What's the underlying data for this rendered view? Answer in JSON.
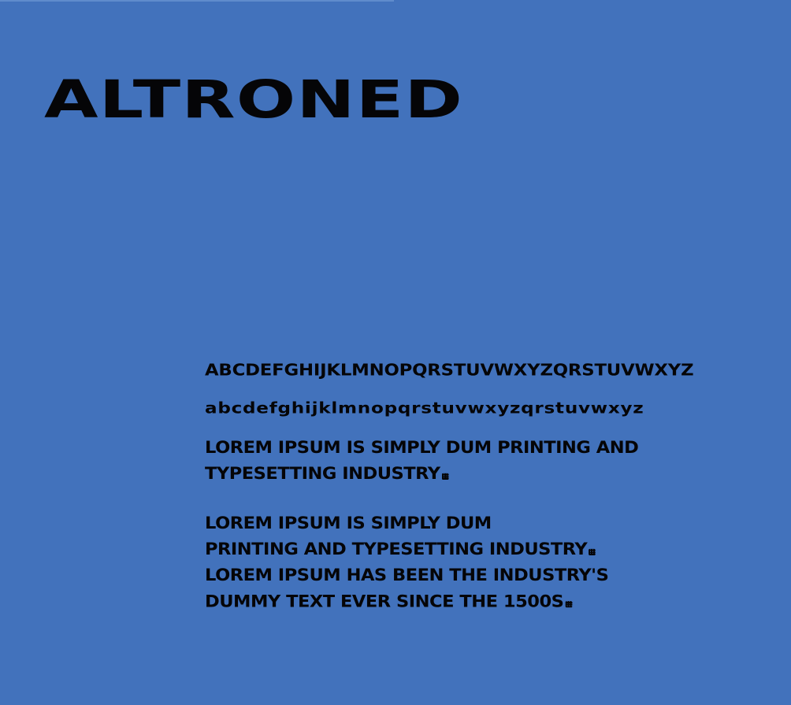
{
  "page": {
    "background": "#4272bc",
    "text_color": "#050507",
    "accent_rule": "#5f8ccc"
  },
  "font": {
    "name": "ALTRONED"
  },
  "specimen": {
    "uppercase_alphabet": "ABCDEFGHIJKLMNOPQRSTUVWXYZQRSTUVWXYZ",
    "lowercase_alphabet": "abcdefghijklmnopqrstuvwxyzqrstuvwxyz",
    "paragraph_one": [
      "LOREM IPSUM IS SIMPLY DUM PRINTING AND",
      "TYPESETTING INDUSTRY"
    ],
    "paragraph_two": [
      "LOREM IPSUM IS SIMPLY DUM",
      "PRINTING AND TYPESETTING INDUSTRY",
      "LOREM IPSUM HAS BEEN THE INDUSTRY'S",
      "DUMMY TEXT EVER SINCE THE 1500S"
    ],
    "punctuation_icon": "period-glyph-icon"
  }
}
